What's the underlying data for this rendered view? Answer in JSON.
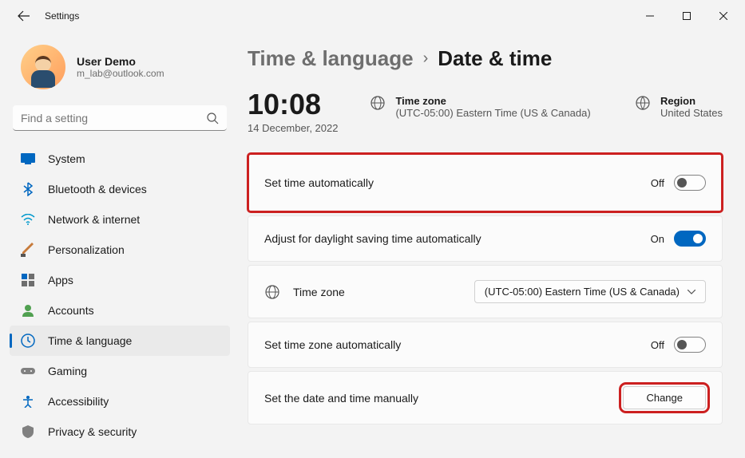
{
  "window": {
    "title": "Settings"
  },
  "profile": {
    "name": "User Demo",
    "email": "m_lab@outlook.com"
  },
  "search": {
    "placeholder": "Find a setting"
  },
  "nav": {
    "items": [
      {
        "label": "System"
      },
      {
        "label": "Bluetooth & devices"
      },
      {
        "label": "Network & internet"
      },
      {
        "label": "Personalization"
      },
      {
        "label": "Apps"
      },
      {
        "label": "Accounts"
      },
      {
        "label": "Time & language"
      },
      {
        "label": "Gaming"
      },
      {
        "label": "Accessibility"
      },
      {
        "label": "Privacy & security"
      }
    ]
  },
  "breadcrumb": {
    "parent": "Time & language",
    "current": "Date & time"
  },
  "clock": {
    "time": "10:08",
    "date": "14 December, 2022"
  },
  "timezone_info": {
    "label": "Time zone",
    "value": "(UTC-05:00) Eastern Time (US & Canada)"
  },
  "region_info": {
    "label": "Region",
    "value": "United States"
  },
  "settings": {
    "set_time_auto": {
      "label": "Set time automatically",
      "state": "Off"
    },
    "dst_auto": {
      "label": "Adjust for daylight saving time automatically",
      "state": "On"
    },
    "timezone_row": {
      "label": "Time zone",
      "selected": "(UTC-05:00) Eastern Time (US & Canada)"
    },
    "set_tz_auto": {
      "label": "Set time zone automatically",
      "state": "Off"
    },
    "set_manual": {
      "label": "Set the date and time manually",
      "button": "Change"
    }
  }
}
